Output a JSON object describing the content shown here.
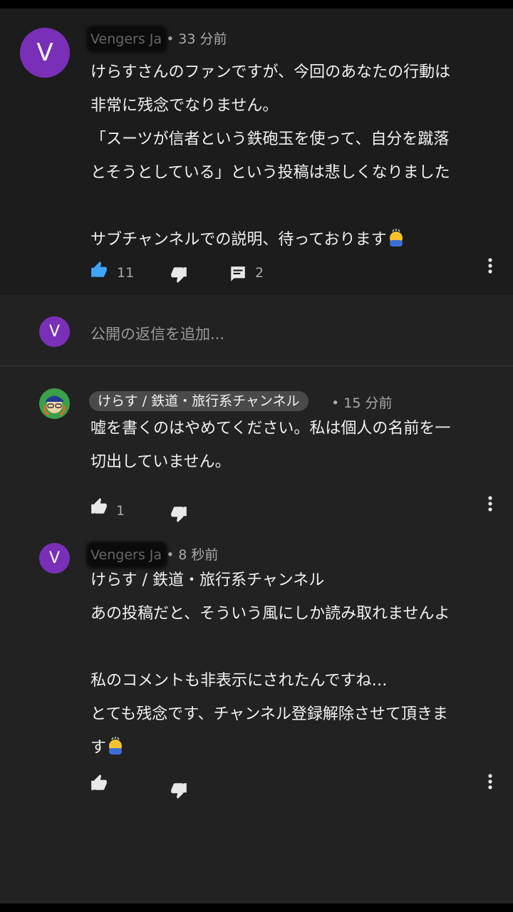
{
  "comments": [
    {
      "author": "Vengers Ja",
      "avatar_letter": "V",
      "time": "• 33 分前",
      "text": "けらすさんのファンですが、今回のあなたの行動は\n非常に残念でなりません。\n「スーツが信者という鉄砲玉を使って、自分を蹴落\nとそうとしている」という投稿は悲しくなりました\n\nサブチャンネルでの説明、待っております",
      "likes": "11",
      "replies": "2"
    },
    {
      "author": "けらす / 鉄道・旅行系チャンネル",
      "time": "• 15 分前",
      "text": "嘘を書くのはやめてください。私は個人の名前を一\n切出していません。",
      "likes": "1"
    },
    {
      "author": "Vengers Ja",
      "avatar_letter": "V",
      "time": "• 8 秒前",
      "text": "けらす / 鉄道・旅行系チャンネル\nあの投稿だと、そういう風にしか読み取れませんよ\n\n私のコメントも非表示にされたんですね…\nとても残念です、チャンネル登録解除させて頂きま\nす"
    }
  ],
  "reply_box": {
    "avatar_letter": "V",
    "placeholder": "公開の返信を追加..."
  },
  "colors": {
    "avatar_purple": "#7a2fb8",
    "like_active": "#3ea6ff",
    "background": "#222222"
  },
  "icons": [
    "thumbs-up-icon",
    "thumbs-down-icon",
    "reply-icon",
    "more-vert-icon",
    "bowing-emoji-icon"
  ]
}
